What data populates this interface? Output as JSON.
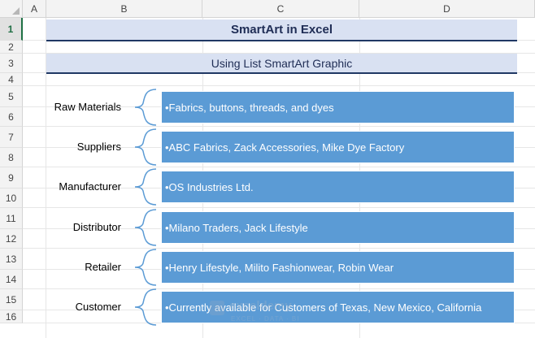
{
  "columns": [
    "A",
    "B",
    "C",
    "D"
  ],
  "rows": [
    "1",
    "2",
    "3",
    "4",
    "5",
    "6",
    "7",
    "8",
    "9",
    "10",
    "11",
    "12",
    "13",
    "14",
    "15",
    "16"
  ],
  "selected_row": "1",
  "title": "SmartArt in Excel",
  "subtitle": "Using List SmartArt Graphic",
  "smartart": {
    "items": [
      {
        "label": "Raw Materials",
        "text": "•Fabrics, buttons, threads, and dyes"
      },
      {
        "label": "Suppliers",
        "text": "•ABC Fabrics, Zack Accessories, Mike Dye Factory"
      },
      {
        "label": "Manufacturer",
        "text": "•OS Industries Ltd."
      },
      {
        "label": "Distributor",
        "text": "•Milano Traders, Jack Lifestyle"
      },
      {
        "label": "Retailer",
        "text": "•Henry Lifestyle, Milito Fashionwear, Robin Wear"
      },
      {
        "label": "Customer",
        "text": "•Currently available for Customers of Texas, New Mexico, California"
      }
    ],
    "box_color": "#5b9bd5",
    "brace_color": "#5b9bd5"
  },
  "watermark": {
    "name": "exceldemy",
    "tagline": "EXCEL · DATA · BI"
  },
  "colors": {
    "header_fill": "#d9e1f2",
    "header_border": "#203864"
  }
}
